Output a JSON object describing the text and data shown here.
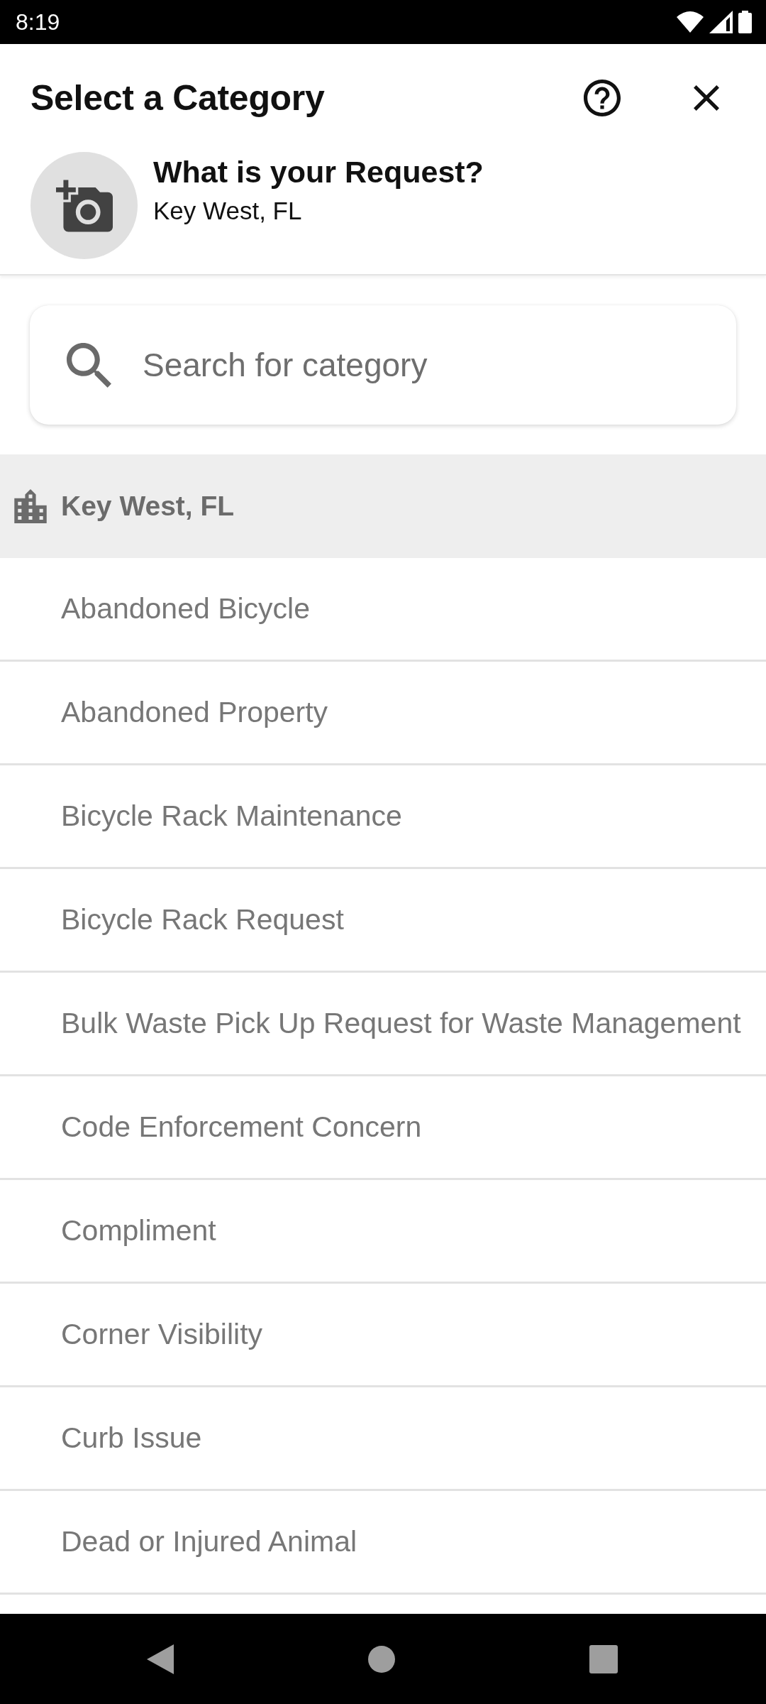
{
  "status_bar": {
    "time": "8:19"
  },
  "header": {
    "title": "Select a Category",
    "request_title": "What is your Request?",
    "location": "Key West, FL"
  },
  "search": {
    "placeholder": "Search for category"
  },
  "section": {
    "title": "Key West, FL"
  },
  "categories": [
    "Abandoned Bicycle",
    "Abandoned Property",
    "Bicycle Rack Maintenance",
    "Bicycle Rack Request",
    "Bulk Waste Pick Up Request for Waste Management",
    "Code Enforcement Concern",
    "Compliment",
    "Corner Visibility",
    "Curb Issue",
    "Dead or Injured Animal"
  ]
}
